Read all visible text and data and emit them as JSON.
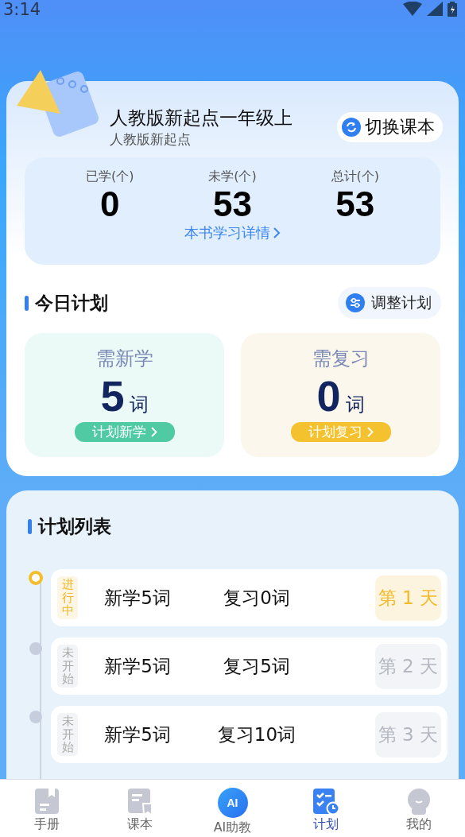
{
  "status_bar": {
    "time": "3:14"
  },
  "book": {
    "title": "人教版新起点一年级上",
    "subtitle": "人教版新起点",
    "switch_label": "切换课本",
    "stats": [
      {
        "label": "已学(个)",
        "value": "0"
      },
      {
        "label": "未学(个)",
        "value": "53"
      },
      {
        "label": "总计(个)",
        "value": "53"
      }
    ],
    "detail_link": "本书学习详情"
  },
  "today_plan": {
    "title": "今日计划",
    "adjust_label": "调整计划",
    "cards": [
      {
        "kind": "new",
        "label": "需新学",
        "value": "5",
        "unit": "词",
        "action": "计划新学"
      },
      {
        "kind": "review",
        "label": "需复习",
        "value": "0",
        "unit": "词",
        "action": "计划复习"
      }
    ]
  },
  "plan_list": {
    "title": "计划列表",
    "items": [
      {
        "in_progress": true,
        "status": "进行中",
        "new_words": "新学5词",
        "review_words": "复习0词",
        "day": "第 1 天"
      },
      {
        "in_progress": false,
        "status": "未开始",
        "new_words": "新学5词",
        "review_words": "复习5词",
        "day": "第 2 天"
      },
      {
        "in_progress": false,
        "status": "未开始",
        "new_words": "新学5词",
        "review_words": "复习10词",
        "day": "第 3 天"
      }
    ]
  },
  "tab_bar": {
    "ai_badge": "AI",
    "items": [
      {
        "kind": "handbook",
        "label": "手册",
        "selected": false
      },
      {
        "kind": "textbook",
        "label": "课本",
        "selected": false
      },
      {
        "kind": "ai",
        "label": "AI助教",
        "selected": false
      },
      {
        "kind": "plan",
        "label": "计划",
        "selected": true
      },
      {
        "kind": "profile",
        "label": "我的",
        "selected": false
      }
    ]
  }
}
